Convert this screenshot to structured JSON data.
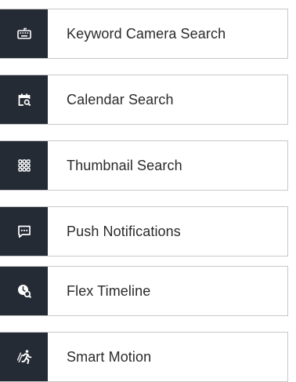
{
  "menu": {
    "items": [
      {
        "label": "Keyword Camera Search",
        "icon": "keyboard-icon"
      },
      {
        "label": "Calendar Search",
        "icon": "calendar-search-icon"
      },
      {
        "label": "Thumbnail Search",
        "icon": "grid-icon"
      },
      {
        "label": "Push Notifications",
        "icon": "chat-notification-icon"
      },
      {
        "label": "Flex Timeline",
        "icon": "clock-search-icon"
      },
      {
        "label": "Smart Motion",
        "icon": "running-person-icon"
      }
    ]
  },
  "colors": {
    "icon_background": "#252b35",
    "icon_foreground": "#ffffff",
    "border": "#c8c8c8",
    "text": "#2a2a2a"
  }
}
